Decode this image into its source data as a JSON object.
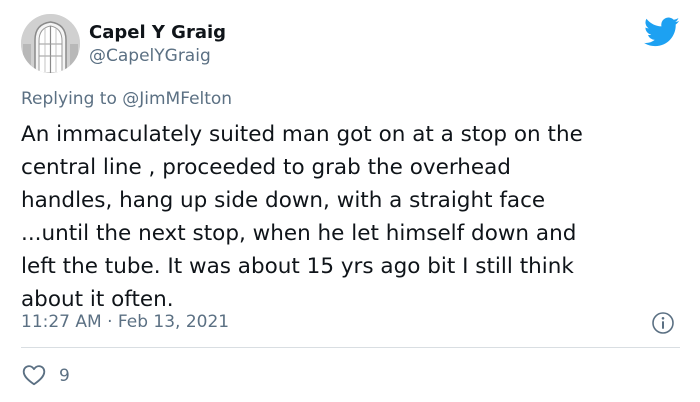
{
  "author": {
    "display_name": "Capel Y Graig",
    "handle": "@CapelYGraig"
  },
  "reply": {
    "prefix": "Replying to",
    "mention": "@JimMFelton"
  },
  "tweet": {
    "lines": [
      "An immaculately suited man got on at a stop on the",
      "central line , proceeded to grab the overhead",
      "handles, hang up side down, with a straight face",
      "...until the next stop, when he let himself down and",
      "left the tube. It was about 15 yrs ago bit I still think",
      "about it often."
    ]
  },
  "meta": {
    "time": "11:27 AM",
    "separator": "·",
    "date": "Feb 13, 2021"
  },
  "stats": {
    "likes": "9"
  },
  "icons": {
    "brand": "twitter-bird-icon",
    "info": "info-icon",
    "like": "heart-icon"
  },
  "colors": {
    "twitter_blue": "#1da1f2",
    "secondary_text": "#5b7083",
    "primary_text": "#0f1419"
  }
}
